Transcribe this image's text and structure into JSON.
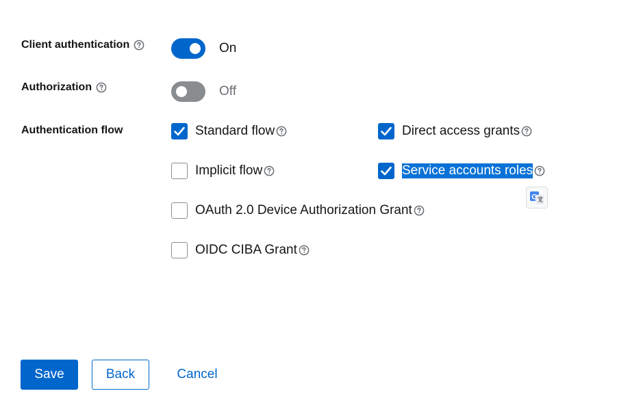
{
  "fields": {
    "client_authentication": {
      "label": "Client authentication",
      "state": "On",
      "enabled": true
    },
    "authorization": {
      "label": "Authorization",
      "state": "Off",
      "enabled": false
    },
    "authentication_flow": {
      "label": "Authentication flow"
    }
  },
  "flows": {
    "standard_flow": {
      "label": "Standard flow",
      "checked": true
    },
    "direct_access_grants": {
      "label": "Direct access grants",
      "checked": true
    },
    "implicit_flow": {
      "label": "Implicit flow",
      "checked": false
    },
    "service_accounts_roles": {
      "label": "Service accounts roles",
      "checked": true,
      "text_selected": true
    },
    "oauth_device_grant": {
      "label": "OAuth 2.0 Device Authorization Grant",
      "checked": false
    },
    "oidc_ciba_grant": {
      "label": "OIDC CIBA Grant",
      "checked": false
    }
  },
  "icons": {
    "help": "question-circle-icon",
    "translate": "google-translate-icon",
    "check": "checkmark-icon"
  },
  "actions": {
    "save": "Save",
    "back": "Back",
    "cancel": "Cancel"
  },
  "colors": {
    "primary": "#0066cc",
    "toggle_off": "#8a8d90",
    "selection": "#0a72d6",
    "text": "#151515",
    "muted": "#6a6e73"
  }
}
